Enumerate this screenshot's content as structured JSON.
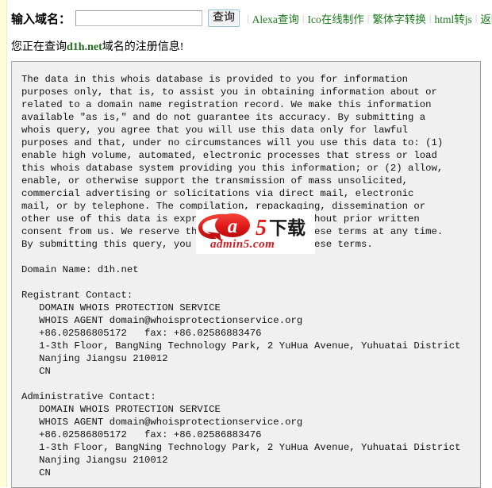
{
  "search": {
    "label": "输入域名：",
    "input_value": "",
    "input_placeholder": "",
    "button_label": "查询"
  },
  "nav": {
    "separator": "|",
    "links": [
      {
        "label": "Alexa查询",
        "name": "nav-link-alexa"
      },
      {
        "label": "Ico在线制作",
        "name": "nav-link-ico"
      },
      {
        "label": "繁体字转换",
        "name": "nav-link-traditional"
      },
      {
        "label": "html转js",
        "name": "nav-link-html2js"
      },
      {
        "label": "返回首页",
        "name": "nav-link-home"
      }
    ]
  },
  "status": {
    "prefix": "您正在查询",
    "domain": "d1h.net",
    "suffix": "域名的注册信息!"
  },
  "watermark": {
    "brand": "a5下载",
    "letter": "a",
    "digit": "5",
    "chinese": "下载",
    "caption": "admin5.com",
    "color": "#d81920"
  },
  "whois": {
    "text": "The data in this whois database is provided to you for information\npurposes only, that is, to assist you in obtaining information about or\nrelated to a domain name registration record. We make this information\navailable \"as is,\" and do not guarantee its accuracy. By submitting a\nwhois query, you agree that you will use this data only for lawful\npurposes and that, under no circumstances will you use this data to: (1)\nenable high volume, automated, electronic processes that stress or load\nthis whois database system providing you this information; or (2) allow,\nenable, or otherwise support the transmission of mass unsolicited,\ncommercial advertising or solicitations via direct mail, electronic\nmail, or by telephone. The compilation, repackaging, dissemination or\nother use of this data is expressly prohibited without prior written\nconsent from us. We reserve the right to modify these terms at any time.\nBy submitting this query, you agree to abide by these terms.\n\nDomain Name: d1h.net\n\nRegistrant Contact:\n   DOMAIN WHOIS PROTECTION SERVICE\n   WHOIS AGENT domain@whoisprotectionservice.org\n   +86.02586805172   fax: +86.02586883476\n   1-3th Floor, BangNing Technology Park, 2 YuHua Avenue, Yuhuatai District\n   Nanjing Jiangsu 210012\n   CN\n\nAdministrative Contact:\n   DOMAIN WHOIS PROTECTION SERVICE\n   WHOIS AGENT domain@whoisprotectionservice.org\n   +86.02586805172   fax: +86.02586883476\n   1-3th Floor, BangNing Technology Park, 2 YuHua Avenue, Yuhuatai District\n   Nanjing Jiangsu 210012\n   CN\n"
  },
  "colors": {
    "link_green": "#1a7a1a",
    "domain_green": "#1d6d1d",
    "box_background": "#f0f0f0",
    "box_border": "#a9a9a9",
    "stripe_yellow": "#fdfbd8",
    "watermark_red": "#d81920"
  }
}
